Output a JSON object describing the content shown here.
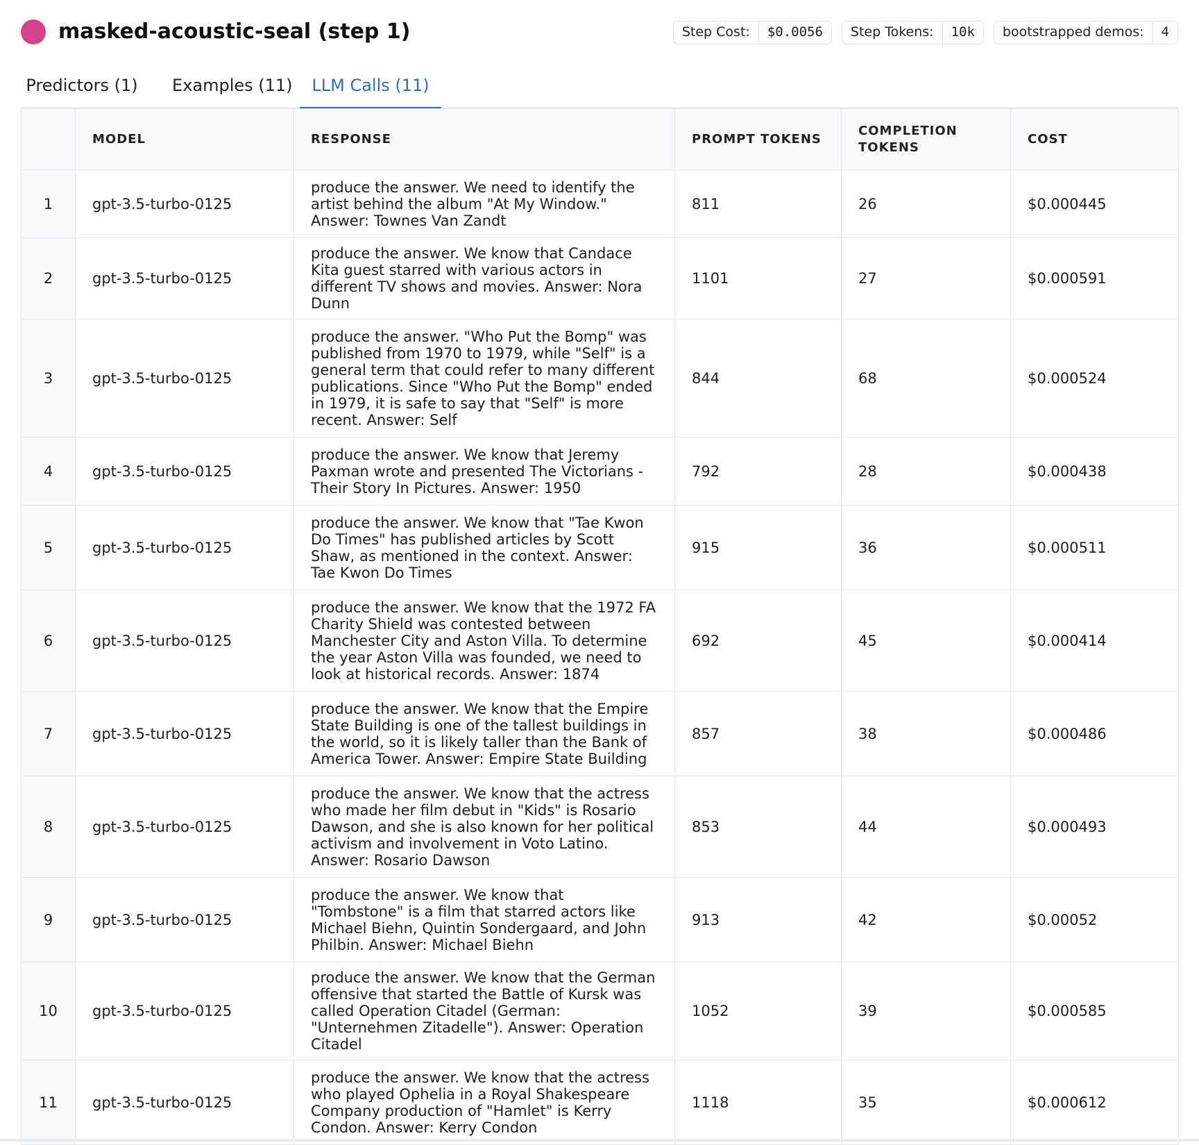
{
  "header": {
    "title": "masked-acoustic-seal (step 1)",
    "dot_color": "#d6418c",
    "stats": [
      {
        "label": "Step Cost:",
        "value": "$0.0056"
      },
      {
        "label": "Step Tokens:",
        "value": "10k"
      },
      {
        "label": "bootstrapped demos:",
        "value": "4"
      }
    ]
  },
  "tabs": [
    {
      "label": "Predictors (1)",
      "active": false
    },
    {
      "label": "Examples (11)",
      "active": false
    },
    {
      "label": "LLM Calls (11)",
      "active": true
    }
  ],
  "table": {
    "columns": [
      "",
      "MODEL",
      "RESPONSE",
      "PROMPT TOKENS",
      "COMPLETION TOKENS",
      "COST"
    ],
    "rows": [
      {
        "n": "1",
        "model": "gpt-3.5-turbo-0125",
        "response": "produce the answer. We need to identify the artist behind the album \"At My Window.\" Answer: Townes Van Zandt",
        "prompt_tokens": "811",
        "completion_tokens": "26",
        "cost": "$0.000445"
      },
      {
        "n": "2",
        "model": "gpt-3.5-turbo-0125",
        "response": "produce the answer. We know that Candace Kita guest starred with various actors in different TV shows and movies. Answer: Nora Dunn",
        "prompt_tokens": "1101",
        "completion_tokens": "27",
        "cost": "$0.000591"
      },
      {
        "n": "3",
        "model": "gpt-3.5-turbo-0125",
        "response": "produce the answer. \"Who Put the Bomp\" was published from 1970 to 1979, while \"Self\" is a general term that could refer to many different publications. Since \"Who Put the Bomp\" ended in 1979, it is safe to say that \"Self\" is more recent. Answer: Self",
        "prompt_tokens": "844",
        "completion_tokens": "68",
        "cost": "$0.000524"
      },
      {
        "n": "4",
        "model": "gpt-3.5-turbo-0125",
        "response": "produce the answer. We know that Jeremy Paxman wrote and presented The Victorians - Their Story In Pictures. Answer: 1950",
        "prompt_tokens": "792",
        "completion_tokens": "28",
        "cost": "$0.000438"
      },
      {
        "n": "5",
        "model": "gpt-3.5-turbo-0125",
        "response": "produce the answer. We know that \"Tae Kwon Do Times\" has published articles by Scott Shaw, as mentioned in the context. Answer: Tae Kwon Do Times",
        "prompt_tokens": "915",
        "completion_tokens": "36",
        "cost": "$0.000511"
      },
      {
        "n": "6",
        "model": "gpt-3.5-turbo-0125",
        "response": "produce the answer. We know that the 1972 FA Charity Shield was contested between Manchester City and Aston Villa. To determine the year Aston Villa was founded, we need to look at historical records. Answer: 1874",
        "prompt_tokens": "692",
        "completion_tokens": "45",
        "cost": "$0.000414"
      },
      {
        "n": "7",
        "model": "gpt-3.5-turbo-0125",
        "response": "produce the answer. We know that the Empire State Building is one of the tallest buildings in the world, so it is likely taller than the Bank of America Tower. Answer: Empire State Building",
        "prompt_tokens": "857",
        "completion_tokens": "38",
        "cost": "$0.000486"
      },
      {
        "n": "8",
        "model": "gpt-3.5-turbo-0125",
        "response": "produce the answer. We know that the actress who made her film debut in \"Kids\" is Rosario Dawson, and she is also known for her political activism and involvement in Voto Latino. Answer: Rosario Dawson",
        "prompt_tokens": "853",
        "completion_tokens": "44",
        "cost": "$0.000493"
      },
      {
        "n": "9",
        "model": "gpt-3.5-turbo-0125",
        "response": "produce the answer. We know that \"Tombstone\" is a film that starred actors like Michael Biehn, Quintin Sondergaard, and John Philbin. Answer: Michael Biehn",
        "prompt_tokens": "913",
        "completion_tokens": "42",
        "cost": "$0.00052"
      },
      {
        "n": "10",
        "model": "gpt-3.5-turbo-0125",
        "response": "produce the answer. We know that the German offensive that started the Battle of Kursk was called Operation Citadel (German: \"Unternehmen Zitadelle\"). Answer: Operation Citadel",
        "prompt_tokens": "1052",
        "completion_tokens": "39",
        "cost": "$0.000585"
      },
      {
        "n": "11",
        "model": "gpt-3.5-turbo-0125",
        "response": "produce the answer. We know that the actress who played Ophelia in a Royal Shakespeare Company production of \"Hamlet\" is Kerry Condon. Answer: Kerry Condon",
        "prompt_tokens": "1118",
        "completion_tokens": "35",
        "cost": "$0.000612"
      }
    ]
  }
}
